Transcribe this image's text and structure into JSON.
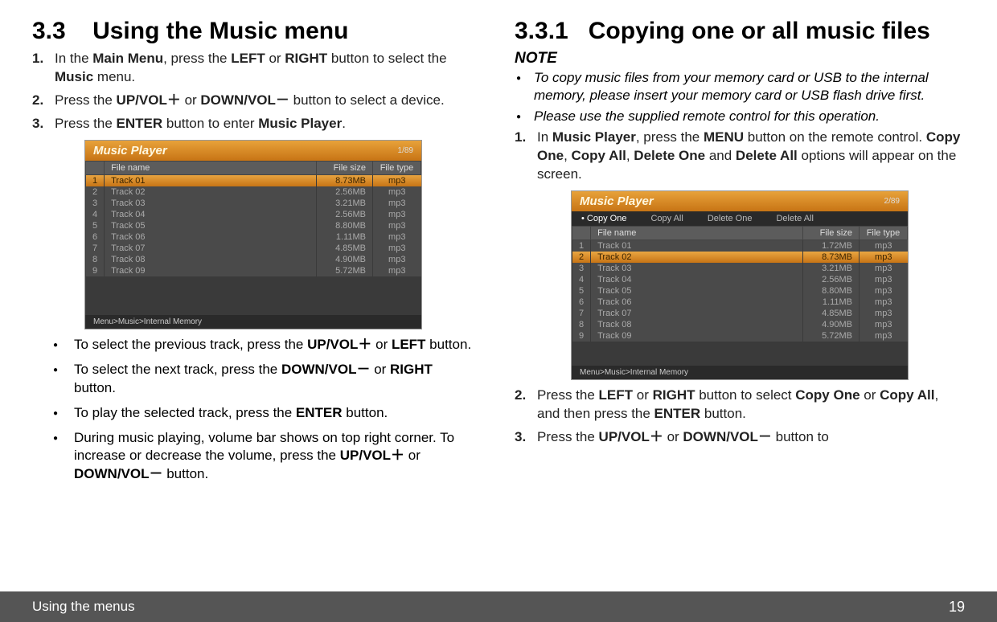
{
  "left": {
    "heading_num": "3.3",
    "heading_text": "Using the Music menu",
    "steps": [
      {
        "n": "1.",
        "pre": "In the ",
        "b1": "Main Menu",
        "mid1": ", press the ",
        "b2": "LEFT",
        "mid2": " or ",
        "b3": "RIGHT",
        "mid3": " button to select the ",
        "b4": "Music",
        "post": " menu."
      },
      {
        "n": "2.",
        "pre": "Press the ",
        "b1": "UP/VOL＋",
        "mid1": " or ",
        "b2": "DOWN/VOL－",
        "mid2": " button to select a device.",
        "b3": "",
        "mid3": "",
        "b4": "",
        "post": ""
      },
      {
        "n": "3.",
        "pre": "Press the ",
        "b1": "ENTER",
        "mid1": " button to enter ",
        "b2": "Music Player",
        "mid2": ".",
        "b3": "",
        "mid3": "",
        "b4": "",
        "post": ""
      }
    ],
    "shot": {
      "title": "Music Player",
      "count": "1/89",
      "headers": {
        "name": "File name",
        "size": "File size",
        "type": "File type"
      },
      "rows": [
        {
          "i": "1",
          "name": "Track 01",
          "size": "8.73MB",
          "type": "mp3",
          "hl": true
        },
        {
          "i": "2",
          "name": "Track 02",
          "size": "2.56MB",
          "type": "mp3"
        },
        {
          "i": "3",
          "name": "Track 03",
          "size": "3.21MB",
          "type": "mp3"
        },
        {
          "i": "4",
          "name": "Track 04",
          "size": "2.56MB",
          "type": "mp3"
        },
        {
          "i": "5",
          "name": "Track 05",
          "size": "8.80MB",
          "type": "mp3"
        },
        {
          "i": "6",
          "name": "Track 06",
          "size": "1.11MB",
          "type": "mp3"
        },
        {
          "i": "7",
          "name": "Track 07",
          "size": "4.85MB",
          "type": "mp3"
        },
        {
          "i": "8",
          "name": "Track 08",
          "size": "4.90MB",
          "type": "mp3"
        },
        {
          "i": "9",
          "name": "Track 09",
          "size": "5.72MB",
          "type": "mp3"
        }
      ],
      "breadcrumb": "Menu>Music>Internal Memory"
    },
    "bullets": [
      {
        "pre": "To select the previous track, press the ",
        "b1": "UP/VOL＋",
        "mid1": " or ",
        "b2": "LEFT",
        "post": " button."
      },
      {
        "pre": "To select the next track, press the ",
        "b1": "DOWN/VOL－",
        "mid1": " or ",
        "b2": "RIGHT",
        "post": " button."
      },
      {
        "pre": "To play the selected track, press the ",
        "b1": "ENTER",
        "mid1": "",
        "b2": "",
        "post": " button."
      },
      {
        "pre": "During music playing, volume bar shows on top right corner. To increase or decrease the volume, press the ",
        "b1": "UP/VOL＋",
        "mid1": " or ",
        "b2": "DOWN/VOL－",
        "post": " button."
      }
    ]
  },
  "right": {
    "heading_num": "3.3.1",
    "heading_text": "Copying one or all music files",
    "note_head": "NOTE",
    "notes": [
      "To copy music files from your memory card or USB to the internal memory, please insert your memory card or USB flash drive first.",
      "Please use the supplied remote control for this operation."
    ],
    "steps": [
      {
        "n": "1.",
        "pre": "In ",
        "b1": "Music Player",
        "mid1": ", press the ",
        "b2": "MENU",
        "mid2": " button on the remote control. ",
        "b3": "Copy One",
        "mid3": ", ",
        "b4": "Copy All",
        "mid4": ", ",
        "b5": "Delete One",
        "mid5": " and ",
        "b6": "Delete All",
        "post": " options will appear on the screen."
      }
    ],
    "shot": {
      "title": "Music Player",
      "count": "2/89",
      "menu": [
        "Copy One",
        "Copy All",
        "Delete One",
        "Delete All"
      ],
      "headers": {
        "name": "File name",
        "size": "File size",
        "type": "File type"
      },
      "rows": [
        {
          "i": "1",
          "name": "Track 01",
          "size": "1.72MB",
          "type": "mp3"
        },
        {
          "i": "2",
          "name": "Track 02",
          "size": "8.73MB",
          "type": "mp3",
          "hl": true
        },
        {
          "i": "3",
          "name": "Track 03",
          "size": "3.21MB",
          "type": "mp3"
        },
        {
          "i": "4",
          "name": "Track 04",
          "size": "2.56MB",
          "type": "mp3"
        },
        {
          "i": "5",
          "name": "Track 05",
          "size": "8.80MB",
          "type": "mp3"
        },
        {
          "i": "6",
          "name": "Track 06",
          "size": "1.11MB",
          "type": "mp3"
        },
        {
          "i": "7",
          "name": "Track 07",
          "size": "4.85MB",
          "type": "mp3"
        },
        {
          "i": "8",
          "name": "Track 08",
          "size": "4.90MB",
          "type": "mp3"
        },
        {
          "i": "9",
          "name": "Track 09",
          "size": "5.72MB",
          "type": "mp3"
        }
      ],
      "breadcrumb": "Menu>Music>Internal Memory"
    },
    "steps2": [
      {
        "n": "2.",
        "pre": "Press the ",
        "b1": "LEFT",
        "mid1": " or ",
        "b2": "RIGHT",
        "mid2": " button to select ",
        "b3": "Copy One",
        "mid3": " or ",
        "b4": "Copy All",
        "mid4": ", and then press the ",
        "b5": "ENTER",
        "post": " button."
      },
      {
        "n": "3.",
        "pre": "Press the ",
        "b1": "UP/VOL＋",
        "mid1": " or ",
        "b2": "DOWN/VOL－",
        "mid2": " button to",
        "b3": "",
        "mid3": "",
        "b4": "",
        "mid4": "",
        "b5": "",
        "post": ""
      }
    ]
  },
  "footer": {
    "chapter": "Using the menus",
    "page": "19"
  }
}
